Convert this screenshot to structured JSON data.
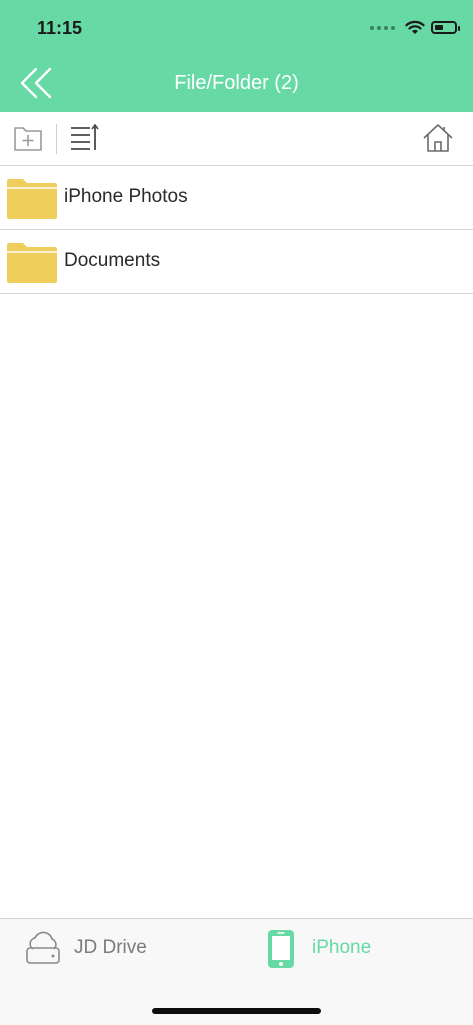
{
  "status_bar": {
    "time": "11:15",
    "battery_level": 0.45
  },
  "navbar": {
    "title": "File/Folder (2)",
    "back_icon": "double-chevron-left-icon"
  },
  "toolbar": {
    "new_folder_icon": "new-folder-icon",
    "sort_icon": "sort-icon",
    "home_icon": "home-icon"
  },
  "files": [
    {
      "name": "iPhone Photos",
      "icon": "folder-icon"
    },
    {
      "name": "Documents",
      "icon": "folder-icon"
    }
  ],
  "tabbar": {
    "tabs": [
      {
        "label": "JD Drive",
        "icon": "cloud-drive-icon",
        "active": false
      },
      {
        "label": "iPhone",
        "icon": "iphone-icon",
        "active": true
      }
    ]
  },
  "colors": {
    "accent": "#66d9a4",
    "folder": "#f0ce5c",
    "inactive_tab": "#7b7b7b"
  }
}
